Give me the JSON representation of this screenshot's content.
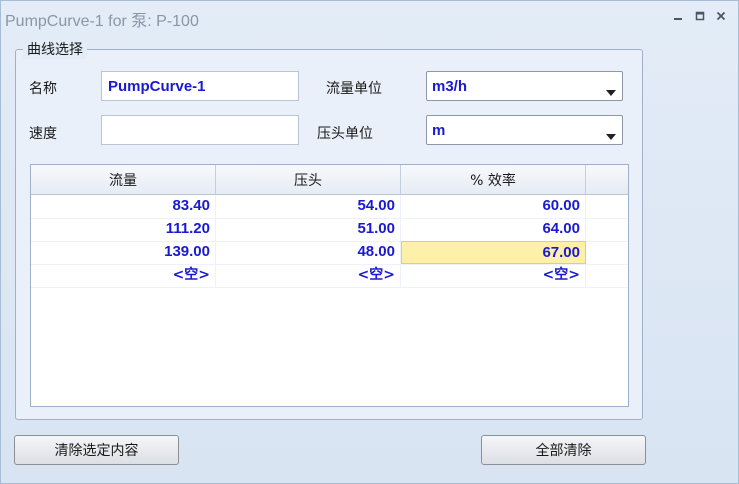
{
  "window": {
    "title": "PumpCurve-1 for 泵: P-100"
  },
  "group": {
    "title": "曲线选择"
  },
  "form": {
    "name_label": "名称",
    "name_value": "PumpCurve-1",
    "speed_label": "速度",
    "speed_value": "",
    "flow_unit_label": "流量单位",
    "flow_unit_value": "m3/h",
    "head_unit_label": "压头单位",
    "head_unit_value": "m"
  },
  "table": {
    "headers": [
      "流量",
      "压头",
      "% 效率"
    ],
    "rows": [
      [
        "83.40",
        "54.00",
        "60.00"
      ],
      [
        "111.20",
        "51.00",
        "64.00"
      ],
      [
        "139.00",
        "48.00",
        "67.00"
      ],
      [
        "<空>",
        "<空>",
        "<空>"
      ]
    ]
  },
  "buttons": {
    "clear_selected": "清除选定内容",
    "clear_all": "全部清除"
  },
  "colors": {
    "value_text": "#1a1ad0",
    "selected_cell": "#fdf0a8"
  }
}
